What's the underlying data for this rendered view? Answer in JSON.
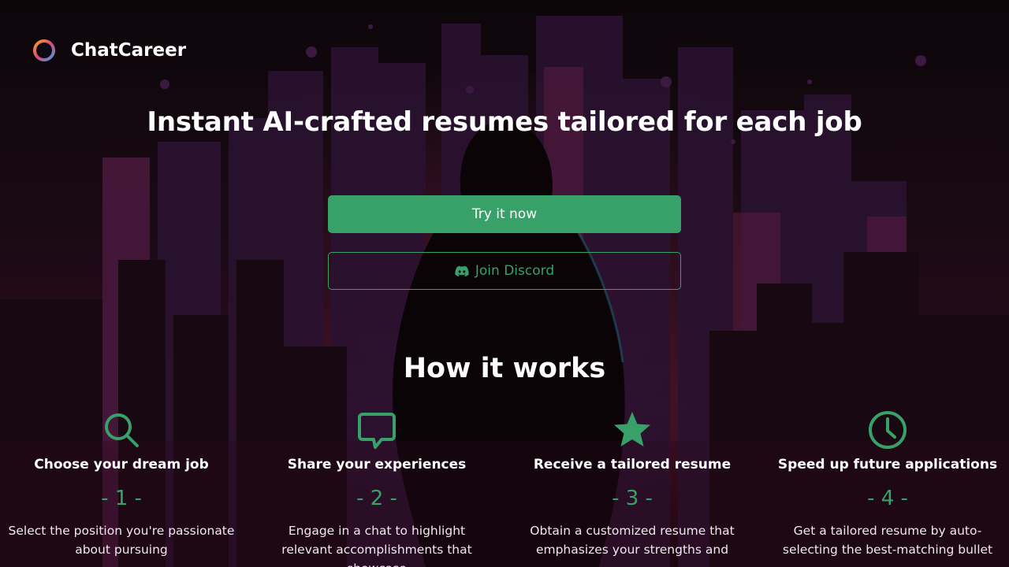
{
  "brand": {
    "name": "ChatCareer",
    "logo": "ring-logo-icon"
  },
  "hero": {
    "title": "Instant AI-crafted resumes tailored for each job"
  },
  "actions": {
    "primary_label": "Try it now",
    "secondary_label": "Join Discord",
    "secondary_icon": "discord-icon"
  },
  "how": {
    "title": "How it works",
    "steps": [
      {
        "icon": "search-icon",
        "title": "Choose your dream job",
        "number": "- 1 -",
        "description": "Select the position you're passionate about pursuing"
      },
      {
        "icon": "chat-bubble-icon",
        "title": "Share your experiences",
        "number": "- 2 -",
        "description": "Engage in a chat to highlight relevant accomplishments that showcase"
      },
      {
        "icon": "star-icon",
        "title": "Receive a tailored resume",
        "number": "- 3 -",
        "description": "Obtain a customized resume that emphasizes your strengths and"
      },
      {
        "icon": "clock-icon",
        "title": "Speed up future applications",
        "number": "- 4 -",
        "description": "Get a tailored resume by auto-selecting the best-matching bullet"
      }
    ]
  },
  "colors": {
    "accent": "#38a169",
    "background": "#0c0509"
  }
}
